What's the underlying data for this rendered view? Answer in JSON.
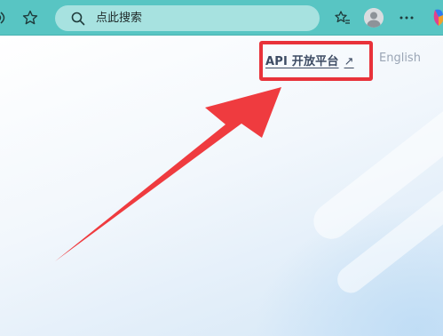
{
  "browser": {
    "address_placeholder": "点此搜索",
    "icons": [
      "read-aloud-icon",
      "favorite-star-icon",
      "search-icon",
      "favorites-icon",
      "profile-avatar",
      "more-menu-icon",
      "edge-copilot-logo"
    ]
  },
  "page": {
    "api_link_label": "API 开放平台",
    "api_link_ext_glyph": "↗",
    "language_label": "English"
  },
  "annotation": {
    "highlight_color": "#e8323a",
    "arrow_color": "#ef3b3f"
  },
  "colors": {
    "toolbar": "#58c5c3",
    "address_bar": "#a7e2e0"
  }
}
